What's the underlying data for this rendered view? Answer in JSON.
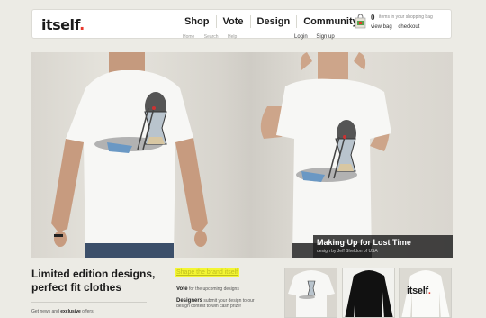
{
  "brand": {
    "name": "itself",
    "dot": "."
  },
  "nav": {
    "items": [
      "Shop",
      "Vote",
      "Design",
      "Community"
    ]
  },
  "cart": {
    "count": "0",
    "text": "items in your shopping bag",
    "view_label": "view bag",
    "checkout_label": "checkout"
  },
  "subnav": {
    "left": [
      "Home",
      "Search",
      "Help"
    ],
    "right": [
      "Login",
      "Sign up"
    ]
  },
  "hero": {
    "title": "Making Up for Lost Time",
    "subtitle": "design by Jeff Sheldon of USA"
  },
  "promo": {
    "headline_1": "Limited edition designs,",
    "headline_2": "perfect fit clothes",
    "news_1": "Get news and ",
    "news_2": "exclusive",
    "news_3": " offers!"
  },
  "shape": {
    "link": "Shape the brand itself",
    "vote_bold": "Vote",
    "vote_rest": " for the upcoming designs",
    "designers_bold": "Designers",
    "designers_rest": " submit your design to our design contest to win cash prize!"
  },
  "thumbs": {
    "third_label": "itself",
    "third_dot": "."
  },
  "colors": {
    "accent_red": "#e8372c",
    "highlight": "#f3f533",
    "background": "#ecebe5"
  }
}
